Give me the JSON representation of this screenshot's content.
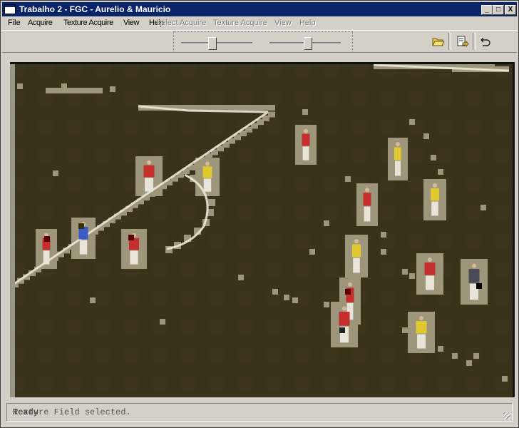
{
  "window": {
    "title": "Trabalho 2 - FGC - Aurelio & Mauricio",
    "minimize_glyph": "_",
    "maximize_glyph": "□",
    "close_glyph": "X"
  },
  "menu": {
    "items": [
      {
        "label": "File",
        "enabled": true
      },
      {
        "label": "Acquire",
        "enabled": true
      },
      {
        "label": "Texture Acquire",
        "enabled": true
      },
      {
        "label": "View",
        "enabled": true
      },
      {
        "label": "Help",
        "enabled": true
      },
      {
        "label": "Select Acquire",
        "enabled": false
      },
      {
        "label": "Texture Acquire",
        "enabled": false
      },
      {
        "label": "View",
        "enabled": false
      },
      {
        "label": "Help",
        "enabled": false
      }
    ],
    "overlap_ghost": "Acquire Texture Acquire View Help"
  },
  "toolbar": {
    "slider1_value": 0.4,
    "slider2_value": 0.5,
    "open_icon": "open-folder-icon",
    "export_icon": "export-icon",
    "undo_icon": "undo-icon"
  },
  "status": {
    "message": "Texture Field selected.",
    "ghost": "Ready"
  },
  "colors": {
    "field": "#3a331b",
    "overlay": "#b9b296",
    "red_team": "#c62d2d",
    "yellow_team": "#e0c830"
  }
}
